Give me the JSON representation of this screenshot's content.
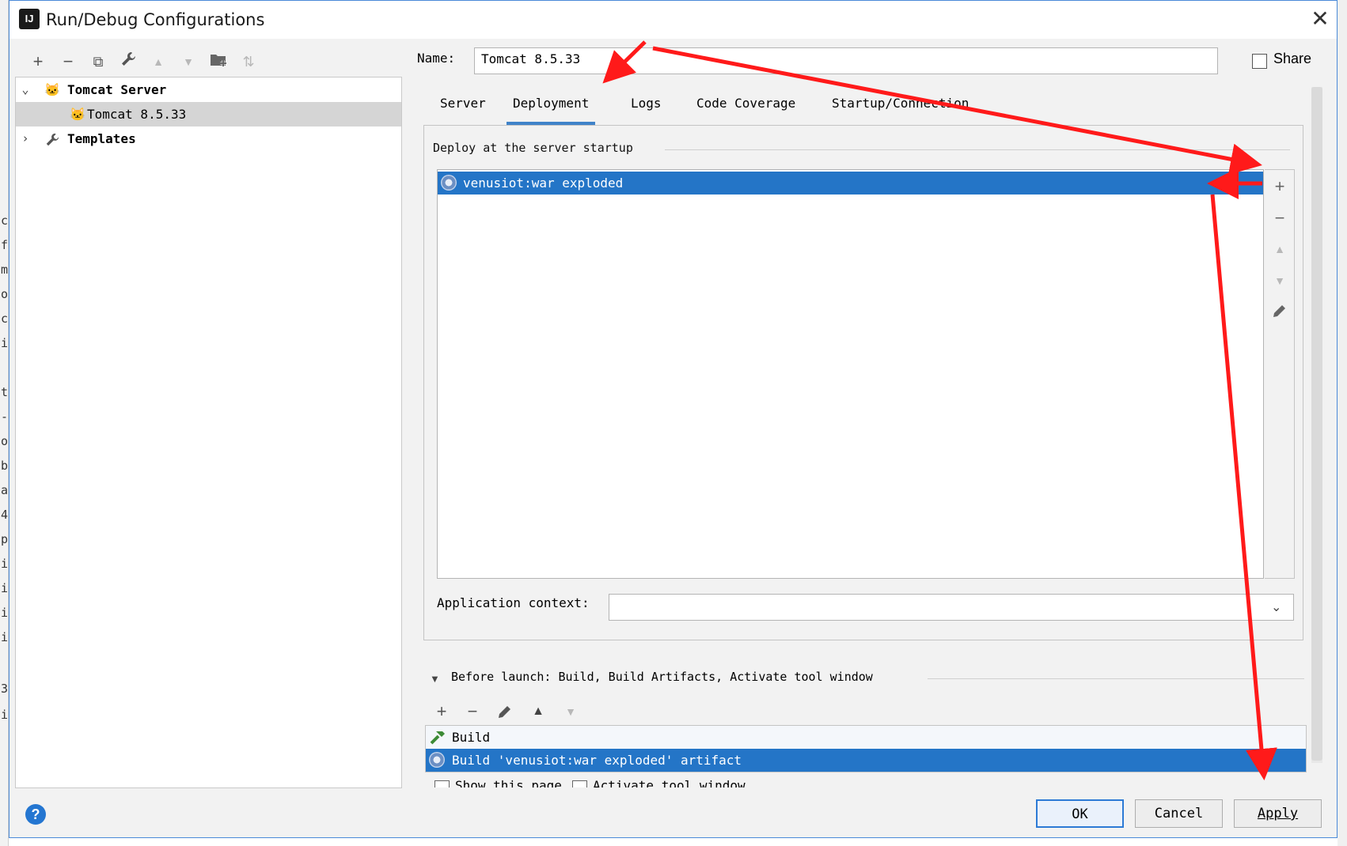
{
  "background_ide": {
    "left_chars": [
      "c",
      "f",
      "m",
      "o",
      "c",
      "i",
      "t",
      "-",
      "o",
      "b",
      "a",
      "4",
      "p",
      "i",
      "i",
      "i",
      "i",
      "3",
      "i"
    ]
  },
  "dialog": {
    "title": "Run/Debug Configurations",
    "app_icon": "intellij-idea-icon",
    "close_icon": "close-icon"
  },
  "toolbar": {
    "items": [
      {
        "name": "add-config-button",
        "glyph": "+"
      },
      {
        "name": "remove-config-button",
        "glyph": "−"
      },
      {
        "name": "copy-config-button",
        "glyph": "⧉"
      },
      {
        "name": "edit-defaults-button",
        "glyph": "🔧"
      },
      {
        "name": "move-up-button",
        "glyph": "▲"
      },
      {
        "name": "move-down-button",
        "glyph": "▼"
      },
      {
        "name": "new-folder-button",
        "glyph": "📁"
      },
      {
        "name": "sort-button",
        "glyph": "⇅"
      }
    ]
  },
  "tree": {
    "group_label": "Tomcat Server",
    "child_label": "Tomcat 8.5.33",
    "templates_label": "Templates"
  },
  "form": {
    "name_label": "Name:",
    "name_value": "Tomcat 8.5.33",
    "share_label": "Share",
    "share_checked": false
  },
  "tabs": [
    {
      "label": "Server",
      "active": false
    },
    {
      "label": "Deployment",
      "active": true
    },
    {
      "label": "Logs",
      "active": false
    },
    {
      "label": "Code Coverage",
      "active": false
    },
    {
      "label": "Startup/Connection",
      "active": false
    }
  ],
  "deployment": {
    "section_title": "Deploy at the server startup",
    "artifacts": [
      "venusiot:war exploded"
    ],
    "selected_index": 0,
    "app_context_label": "Application context:",
    "app_context_value": ""
  },
  "before_launch": {
    "label": "Before launch: Build, Build Artifacts, Activate tool window",
    "tasks": [
      {
        "label": "Build",
        "icon": "hammer-icon",
        "selected": false
      },
      {
        "label": "Build 'venusiot:war exploded' artifact",
        "icon": "artifact-icon",
        "selected": true
      }
    ],
    "cut_options": [
      "Show this page",
      "Activate tool window"
    ]
  },
  "buttons": {
    "ok": "OK",
    "cancel": "Cancel",
    "apply": "Apply",
    "help": "?"
  },
  "colors": {
    "selection": "#2475c7",
    "active_tab": "#4083c9",
    "annotation_arrow": "#ff1a1a"
  }
}
